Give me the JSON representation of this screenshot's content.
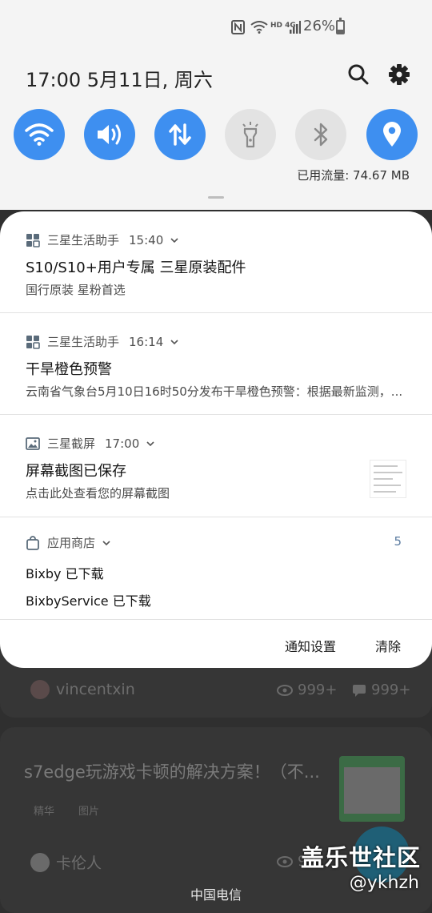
{
  "status_bar": {
    "battery_percent": "26%",
    "network": "HD 4G"
  },
  "header": {
    "datetime": "17:00  5月11日, 周六",
    "search_icon": "search-icon",
    "settings_icon": "gear-icon"
  },
  "quick_toggles": [
    {
      "name": "wifi",
      "icon": "wifi-icon",
      "state": "on"
    },
    {
      "name": "sound",
      "icon": "volume-icon",
      "state": "on"
    },
    {
      "name": "mobile-data",
      "icon": "data-transfer-icon",
      "state": "on"
    },
    {
      "name": "flashlight",
      "icon": "flashlight-icon",
      "state": "off"
    },
    {
      "name": "bluetooth",
      "icon": "bluetooth-icon",
      "state": "off"
    },
    {
      "name": "location",
      "icon": "location-icon",
      "state": "on"
    }
  ],
  "data_usage": "已用流量: 74.67 MB",
  "notifications": [
    {
      "app": "三星生活助手",
      "time": "15:40",
      "title": "S10/S10+用户专属  三星原装配件",
      "text": "国行原装 星粉首选"
    },
    {
      "app": "三星生活助手",
      "time": "16:14",
      "title": "干旱橙色预警",
      "text": "云南省气象台5月10日16时50分发布干旱橙色预警：根据最新监测，..."
    },
    {
      "app": "三星截屏",
      "time": "17:00",
      "title": "屏幕截图已保存",
      "text": "点击此处查看您的屏幕截图"
    },
    {
      "app": "应用商店",
      "count": "5",
      "lines": [
        "Bixby 已下载",
        "BixbyService 已下载"
      ]
    }
  ],
  "actions": {
    "settings_label": "通知设置",
    "clear_label": "清除"
  },
  "background": {
    "user1": "vincentxin",
    "views1": "999+",
    "comments1": "999+",
    "post_title": "s7edge玩游戏卡顿的解决方案！（不...",
    "tag1": "精华",
    "tag2": "图片",
    "user2": "卡伦人",
    "views2": "99"
  },
  "watermark": {
    "line1": "盖乐世社区",
    "line2": "@ykhzh"
  },
  "carrier": "中国电信",
  "colors": {
    "accent": "#3e8ff0",
    "toggle_off": "#e3e3e3",
    "panel_bg": "#f4f4f4"
  }
}
